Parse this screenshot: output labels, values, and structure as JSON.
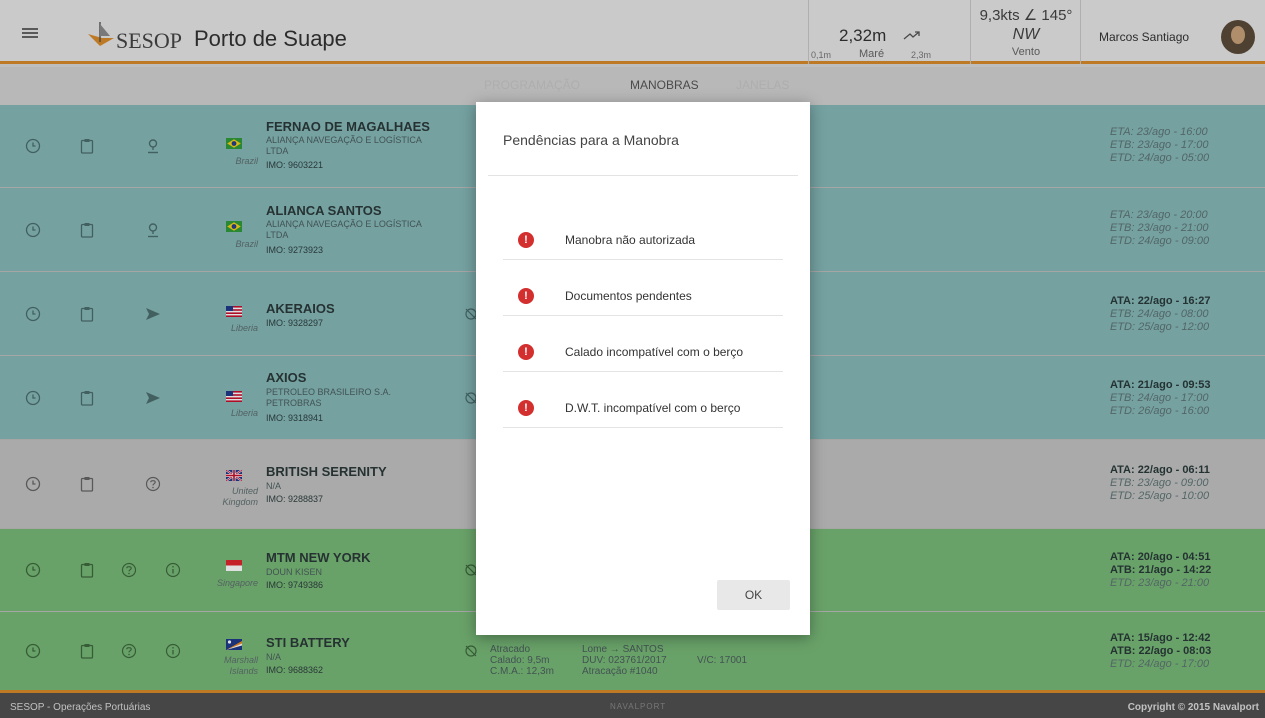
{
  "header": {
    "logo_text": "SESOP",
    "port_name": "Porto de Suape",
    "tide": {
      "value": "2,32m",
      "min": "0,1m",
      "label": "Maré",
      "max": "2,3m"
    },
    "wind": {
      "value": "9,3kts ∠ 145°",
      "direction": "NW",
      "label": "Vento"
    },
    "user_name": "Marcos Santiago"
  },
  "tabs": [
    {
      "label": "PROGRAMAÇÃO"
    },
    {
      "label": "MANOBRAS"
    },
    {
      "label": "JANELAS"
    }
  ],
  "rows": [
    {
      "name": "FERNAO DE MAGALHAES",
      "subs": [
        "ALIANÇA NAVEGAÇÃO E LOGÍSTICA",
        "LTDA"
      ],
      "imo": "IMO: 9603221",
      "country": "Brazil",
      "t1": "ETA: 23/ago - 16:00",
      "t2": "ETB: 23/ago - 17:00",
      "t3": "ETD: 24/ago - 05:00"
    },
    {
      "name": "ALIANCA SANTOS",
      "subs": [
        "ALIANÇA NAVEGAÇÃO E LOGÍSTICA",
        "LTDA"
      ],
      "imo": "IMO: 9273923",
      "country": "Brazil",
      "t1": "ETA: 23/ago - 20:00",
      "t2": "ETB: 23/ago - 21:00",
      "t3": "ETD: 24/ago - 09:00"
    },
    {
      "name": "AKERAIOS",
      "subs": [],
      "imo": "IMO: 9328297",
      "country": "Liberia",
      "t1": "ATA: 22/ago - 16:27",
      "t2": "ETB: 24/ago - 08:00",
      "t3": "ETD: 25/ago - 12:00"
    },
    {
      "name": "AXIOS",
      "subs": [
        "PETROLEO BRASILEIRO S.A.",
        "PETROBRAS"
      ],
      "imo": "IMO: 9318941",
      "country": "Liberia",
      "t1": "ATA: 21/ago - 09:53",
      "t2": "ETB: 24/ago - 17:00",
      "t3": "ETD: 26/ago - 16:00"
    },
    {
      "name": "BRITISH SERENITY",
      "subs": [
        "N/A"
      ],
      "imo": "IMO: 9288837",
      "country": "United Kingdom",
      "t1": "ATA: 22/ago - 06:11",
      "t2": "ETB: 23/ago - 09:00",
      "t3": "ETD: 25/ago - 10:00"
    },
    {
      "name": "MTM NEW YORK",
      "subs": [
        "DOUN KISEN"
      ],
      "imo": "IMO: 9749386",
      "country": "Singapore",
      "t1": "ATA: 20/ago - 04:51",
      "t2": "ATB: 21/ago - 14:22",
      "t3": "ETD: 23/ago - 21:00"
    },
    {
      "name": "STI BATTERY",
      "subs": [
        "N/A"
      ],
      "imo": "IMO: 9688362",
      "country": "Marshall Islands",
      "t1": "ATA: 15/ago - 12:42",
      "t2": "ATB: 22/ago - 08:03",
      "t3": "ETD: 24/ago - 17:00"
    }
  ],
  "last_row_details": {
    "status": "Atracado",
    "calado": "Calado: 9,5m",
    "cma": "C.M.A.: 12,3m",
    "route": "Lome → SANTOS",
    "duv": "DUV: 023761/2017",
    "atracacao": "Atracação #1040",
    "vc": "V/C: 17001"
  },
  "footer": {
    "left": "SESOP - Operações Portuárias",
    "middle": "NAVALPORT",
    "right": "Copyright © 2015 Navalport"
  },
  "modal": {
    "title": "Pendências para a Manobra",
    "items": [
      {
        "text": "Manobra não autorizada"
      },
      {
        "text": "Documentos pendentes"
      },
      {
        "text": "Calado incompatível com o berço"
      },
      {
        "text": "D.W.T. incompatível com o berço"
      }
    ],
    "ok_label": "OK",
    "alert_glyph": "!"
  }
}
